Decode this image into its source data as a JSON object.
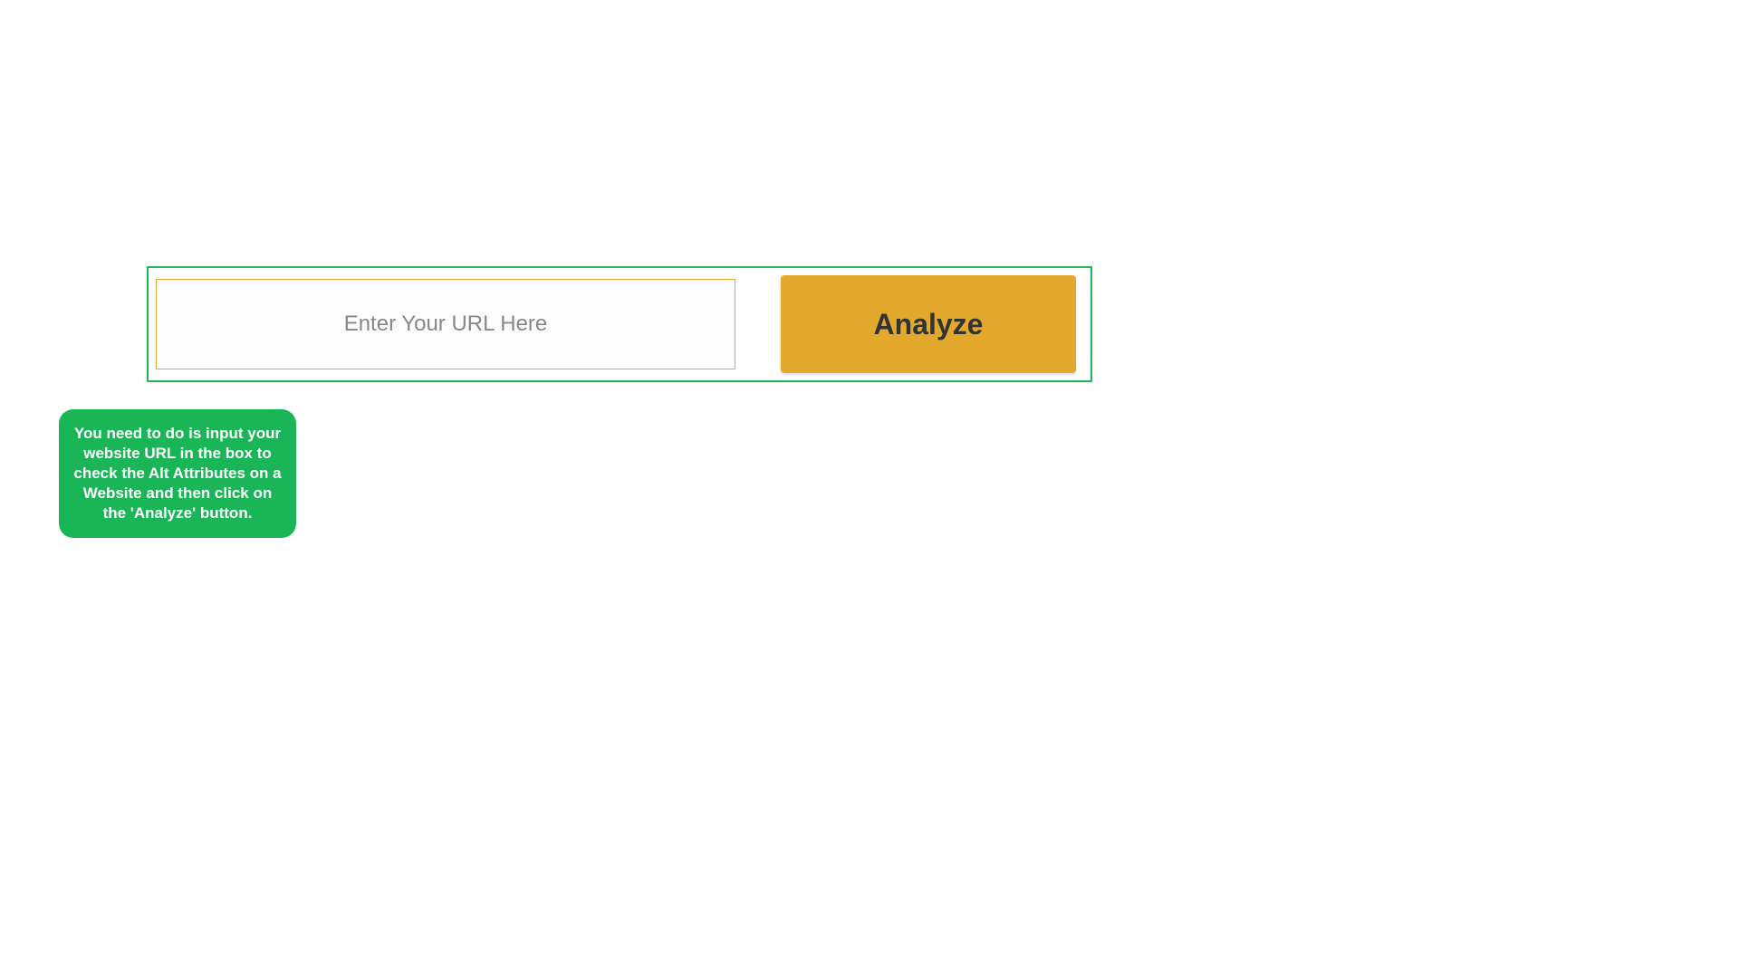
{
  "form": {
    "url_input_placeholder": "Enter Your URL Here",
    "analyze_button_label": "Analyze"
  },
  "tooltip": {
    "text": "You need to do is input your website URL in the box to check the Alt Attributes on a Website and then click on the 'Analyze' button."
  }
}
